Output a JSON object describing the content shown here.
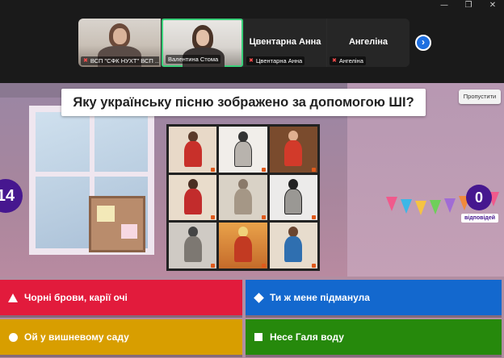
{
  "window_controls": {
    "minimize": "—",
    "restore": "❐",
    "close": "✕"
  },
  "participants": [
    {
      "label": "ВСП \"СФК НУХТ\" ВСП ...",
      "muted": true
    },
    {
      "label": "Валентина Стома",
      "muted": false,
      "active_speaker": true
    },
    {
      "name": "Цвентарна Анна",
      "label": "Цвентарна Анна",
      "muted": true
    },
    {
      "name": "Ангеліна",
      "label": "Ангеліна",
      "muted": true
    }
  ],
  "strip_next_icon": "chevron-right-icon",
  "question": {
    "text": "Яку українську пісню зображено за допомогою ШІ?",
    "skip_label": "Пропустити"
  },
  "timer": {
    "value": "14"
  },
  "answers_counter": {
    "value": "0",
    "caption": "відповідей"
  },
  "answers": [
    {
      "shape": "triangle",
      "text": "Чорні брови, карії очі",
      "color": "#e21b3c"
    },
    {
      "shape": "diamond",
      "text": "Ти ж мене підманула",
      "color": "#1368ce"
    },
    {
      "shape": "circle",
      "text": "Ой у вишневому саду",
      "color": "#d89e00"
    },
    {
      "shape": "square",
      "text": "Несе Галя воду",
      "color": "#26890c"
    }
  ],
  "theme": {
    "kahoot_purple": "#46178f",
    "active_border": "#3ad07a"
  }
}
